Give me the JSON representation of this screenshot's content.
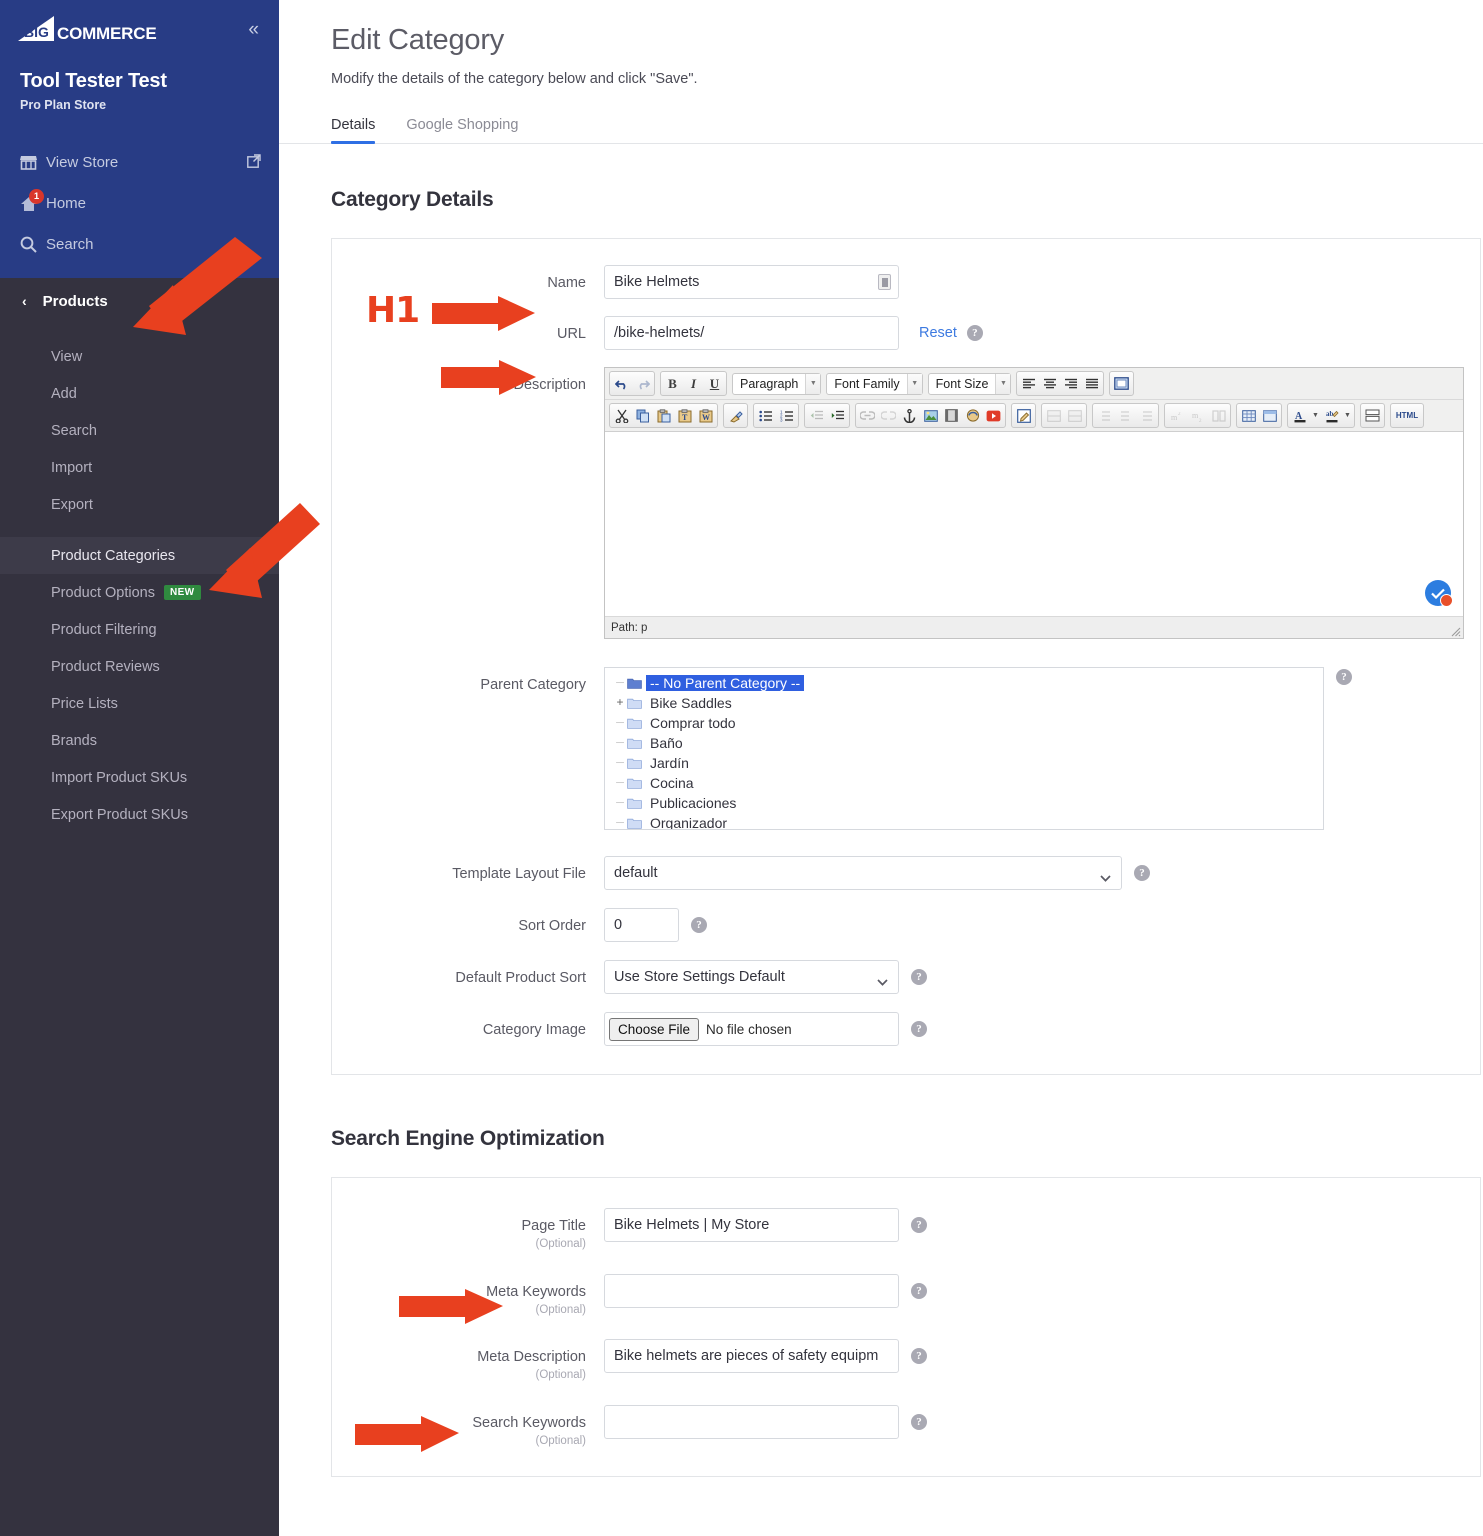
{
  "sidebar": {
    "brand": {
      "logo_text": "COMMERCE",
      "logo_mark": "BIG",
      "collapse_icon": "chevron-double-left"
    },
    "store_name": "Tool Tester Test",
    "store_plan": "Pro Plan Store",
    "links": [
      {
        "label": "View Store",
        "icon": "storefront-icon",
        "external": true
      },
      {
        "label": "Home",
        "icon": "home-icon",
        "badge": "1"
      },
      {
        "label": "Search",
        "icon": "search-icon"
      }
    ],
    "section": {
      "label": "Products",
      "back_icon": "chevron-left"
    },
    "items": [
      {
        "label": "View"
      },
      {
        "label": "Add"
      },
      {
        "label": "Search"
      },
      {
        "label": "Import"
      },
      {
        "label": "Export"
      },
      {
        "label": "Product Categories",
        "active": true
      },
      {
        "label": "Product Options",
        "tag": "NEW"
      },
      {
        "label": "Product Filtering"
      },
      {
        "label": "Product Reviews"
      },
      {
        "label": "Price Lists"
      },
      {
        "label": "Brands"
      },
      {
        "label": "Import Product SKUs"
      },
      {
        "label": "Export Product SKUs"
      }
    ],
    "colors": {
      "top_bg": "#283c85",
      "dark_bg": "#34323f",
      "active_bg": "#3d3b49",
      "badge": "#d9362b",
      "new_tag": "#2f8a3f"
    }
  },
  "header": {
    "title": "Edit Category",
    "subtitle": "Modify the details of the category below and click \"Save\".",
    "tabs": [
      {
        "label": "Details",
        "active": true
      },
      {
        "label": "Google Shopping",
        "active": false
      }
    ]
  },
  "details": {
    "section_title": "Category Details",
    "name": {
      "label": "Name",
      "value": "Bike Helmets"
    },
    "url": {
      "label": "URL",
      "value": "/bike-helmets/",
      "reset_label": "Reset"
    },
    "description": {
      "label": "Description",
      "value": "",
      "path_status": "Path: p",
      "toolbar_selects": [
        {
          "name": "block-format",
          "value": "Paragraph"
        },
        {
          "name": "font-family",
          "value": "Font Family"
        },
        {
          "name": "font-size",
          "value": "Font Size"
        }
      ]
    },
    "parent_category": {
      "label": "Parent Category",
      "nodes": [
        {
          "label": "-- No Parent Category --",
          "selected": true,
          "expandable": false
        },
        {
          "label": "Bike Saddles",
          "selected": false,
          "expandable": true
        },
        {
          "label": "Comprar todo",
          "selected": false,
          "expandable": false
        },
        {
          "label": "Baño",
          "selected": false,
          "expandable": false
        },
        {
          "label": "Jardín",
          "selected": false,
          "expandable": false
        },
        {
          "label": "Cocina",
          "selected": false,
          "expandable": false
        },
        {
          "label": "Publicaciones",
          "selected": false,
          "expandable": false
        },
        {
          "label": "Organizador",
          "selected": false,
          "expandable": false
        }
      ]
    },
    "template_layout": {
      "label": "Template Layout File",
      "value": "default"
    },
    "sort_order": {
      "label": "Sort Order",
      "value": "0"
    },
    "default_product_sort": {
      "label": "Default Product Sort",
      "value": "Use Store Settings Default"
    },
    "category_image": {
      "label": "Category Image",
      "button_label": "Choose File",
      "status": "No file chosen"
    }
  },
  "seo": {
    "section_title": "Search Engine Optimization",
    "optional_note": "(Optional)",
    "fields": [
      {
        "label": "Page Title",
        "value": "Bike Helmets | My Store",
        "placeholder": ""
      },
      {
        "label": "Meta Keywords",
        "value": "",
        "placeholder": ""
      },
      {
        "label": "Meta Description",
        "value": "Bike helmets are pieces of safety equipm",
        "placeholder": ""
      },
      {
        "label": "Search Keywords",
        "value": "",
        "placeholder": ""
      }
    ]
  },
  "annotations": {
    "h1_label": "H1",
    "arrow_color": "#e8401f",
    "arrows": [
      {
        "target": "sidebar-section-products"
      },
      {
        "target": "sidebar-item-product-categories"
      },
      {
        "target": "name-field"
      },
      {
        "target": "url-field"
      },
      {
        "target": "page-title-field"
      },
      {
        "target": "meta-description-field"
      }
    ]
  }
}
